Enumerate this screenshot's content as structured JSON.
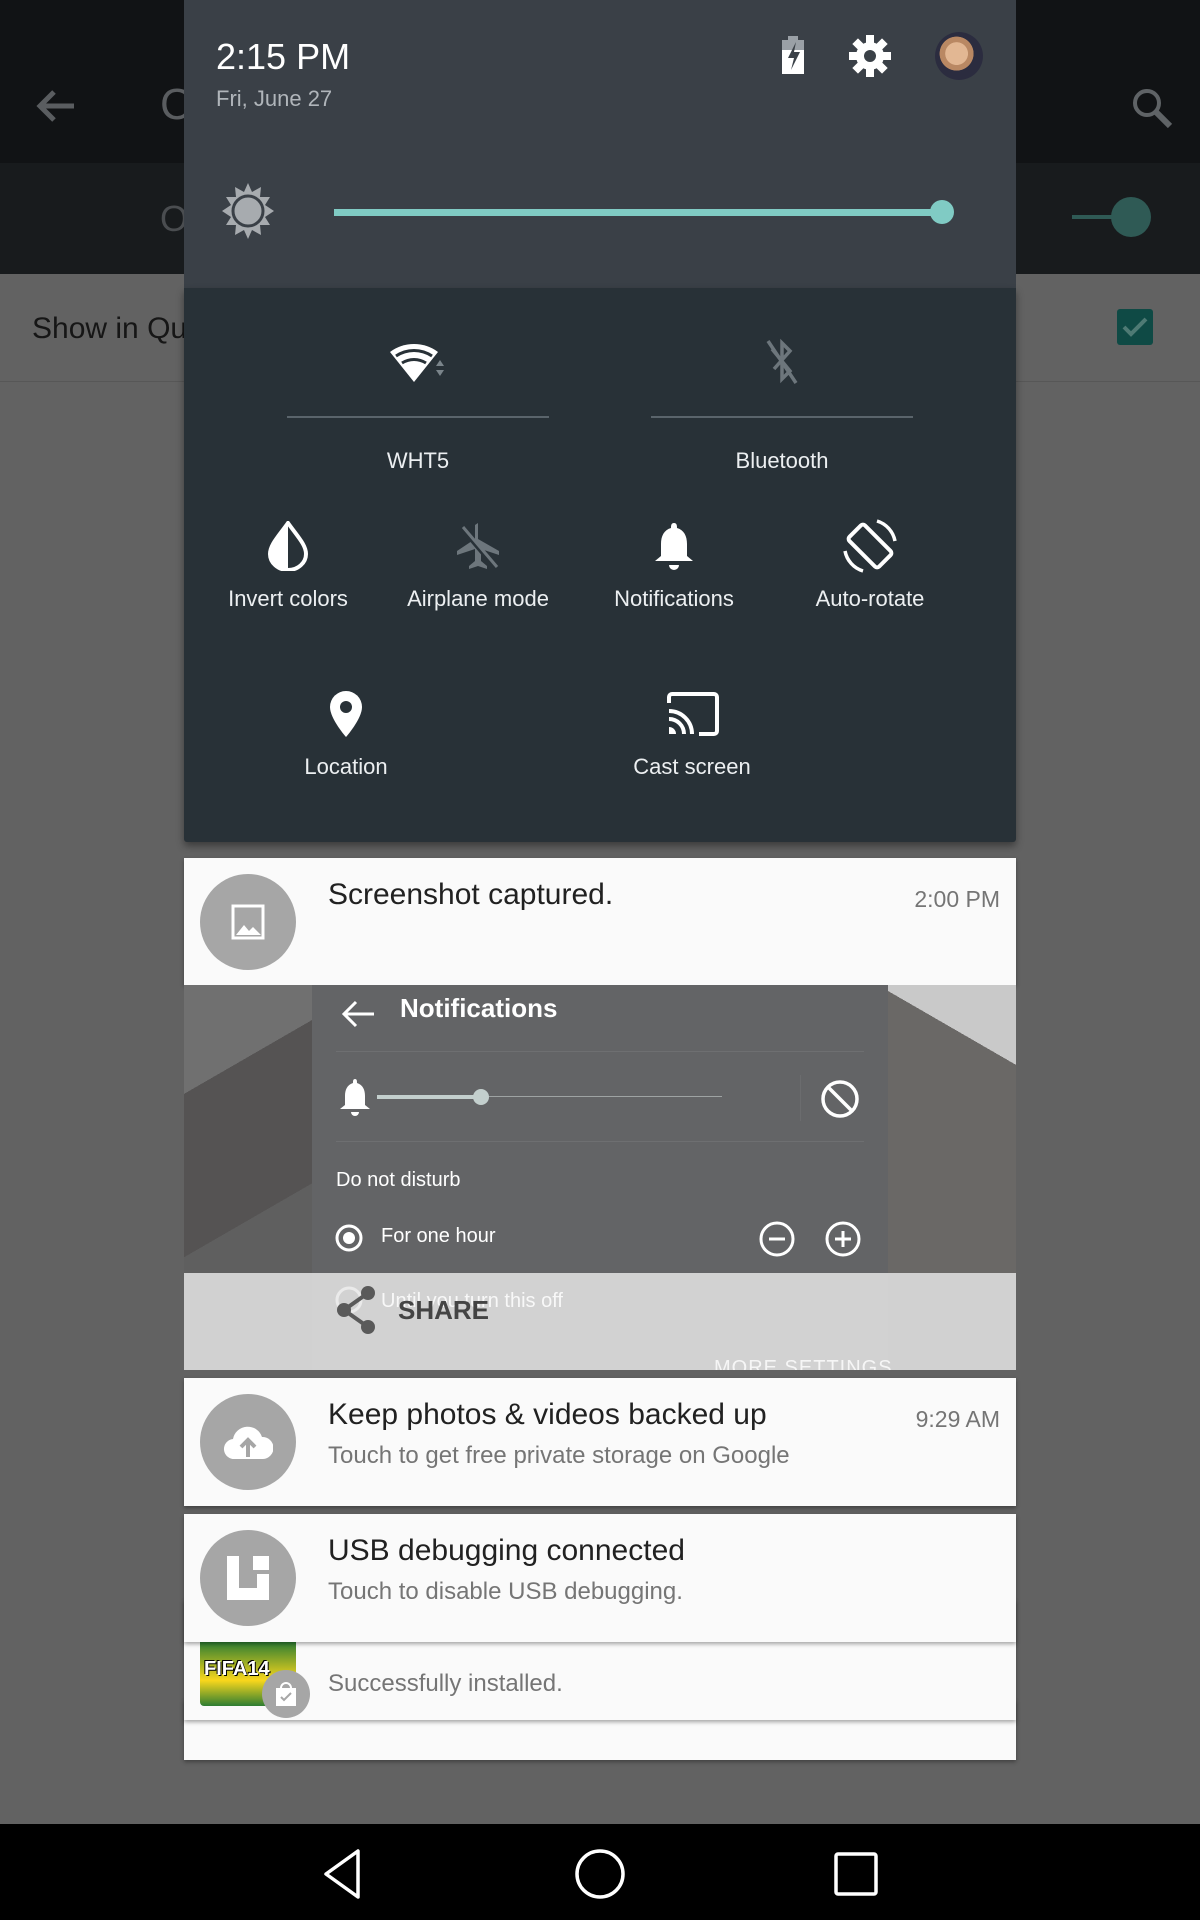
{
  "background_app": {
    "title_partial": "C",
    "subbar_partial": "O",
    "row_label_partial": "Show in Qu",
    "row_checked": true,
    "switch_on": true,
    "icons": [
      "back-arrow-icon",
      "search-icon"
    ]
  },
  "quick_settings": {
    "time": "2:15 PM",
    "date": "Fri, June 27",
    "header_icons": [
      "battery-charging-icon",
      "settings-gear-icon",
      "user-avatar"
    ],
    "brightness": {
      "level_percent": 100,
      "icon": "brightness-sun-icon"
    },
    "accent_color": "#80cbc4",
    "tiles_large": [
      {
        "id": "wifi",
        "label": "WHT5",
        "icon": "wifi-icon",
        "active": true
      },
      {
        "id": "bluetooth",
        "label": "Bluetooth",
        "icon": "bluetooth-off-icon",
        "active": false
      }
    ],
    "tiles_small": [
      {
        "id": "invert",
        "label": "Invert colors",
        "icon": "invert-colors-icon",
        "active": true
      },
      {
        "id": "airplane",
        "label": "Airplane mode",
        "icon": "airplane-off-icon",
        "active": false
      },
      {
        "id": "notifications",
        "label": "Notifications",
        "icon": "bell-icon",
        "active": true
      },
      {
        "id": "rotate",
        "label": "Auto-rotate",
        "icon": "auto-rotate-icon",
        "active": true
      },
      {
        "id": "location",
        "label": "Location",
        "icon": "location-pin-icon",
        "active": true
      },
      {
        "id": "cast",
        "label": "Cast screen",
        "icon": "cast-icon",
        "active": true
      }
    ]
  },
  "notifications": [
    {
      "id": "screenshot",
      "title": "Screenshot captured.",
      "time": "2:00 PM",
      "icon": "image-icon",
      "preview": {
        "title": "Notifications",
        "volume_level": 0.3,
        "section": "Do not disturb",
        "option_1": "For one hour",
        "option_2": "Until you turn this off",
        "more": "MORE SETTINGS"
      },
      "action": {
        "label": "SHARE",
        "icon": "share-icon"
      }
    },
    {
      "id": "backup",
      "title": "Keep photos & videos backed up",
      "text": "Touch to get free private storage on Google",
      "time": "9:29 AM",
      "icon": "cloud-upload-icon"
    },
    {
      "id": "usb",
      "title": "USB debugging connected",
      "text": "Touch to disable USB debugging.",
      "icon": "usb-debug-icon"
    },
    {
      "id": "fifa",
      "text": "Successfully installed.",
      "app_logo_text": "FIFA14",
      "icon": "play-store-badge-icon"
    }
  ],
  "navbar": {
    "buttons": [
      {
        "id": "back",
        "icon": "nav-back-icon"
      },
      {
        "id": "home",
        "icon": "nav-home-icon"
      },
      {
        "id": "recents",
        "icon": "nav-recents-icon"
      }
    ]
  }
}
